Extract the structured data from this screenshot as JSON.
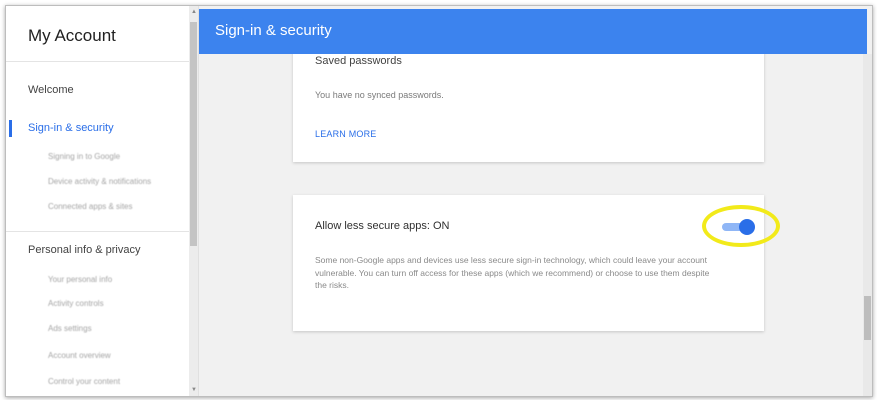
{
  "sidebar": {
    "title": "My Account",
    "items": [
      {
        "label": "Welcome",
        "active": false
      },
      {
        "label": "Sign-in & security",
        "active": true,
        "subitems": [
          "Signing in to Google",
          "Device activity & notifications",
          "Connected apps & sites"
        ]
      },
      {
        "label": "Personal info & privacy",
        "active": false,
        "subitems": [
          "Your personal info",
          "Activity controls",
          "Ads settings",
          "Account overview",
          "Control your content"
        ]
      }
    ]
  },
  "header": {
    "title": "Sign-in & security"
  },
  "saved_passwords": {
    "heading": "Saved passwords",
    "text": "You have no synced passwords.",
    "link": "LEARN MORE"
  },
  "less_secure": {
    "title": "Allow less secure apps: ON",
    "body": "Some non-Google apps and devices use less secure sign-in technology, which could leave your account vulnerable. You can turn off access for these apps (which we recommend) or choose to use them despite the risks.",
    "toggle_on": true
  },
  "colors": {
    "accent": "#3c83ee",
    "highlight": "#f2ea1a"
  }
}
